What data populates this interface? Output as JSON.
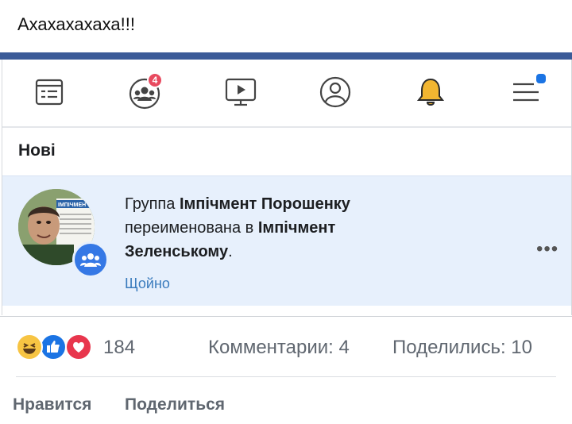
{
  "post": {
    "text": "Ахахахахаха!!!"
  },
  "screenshot": {
    "tabs": [
      {
        "icon": "feed-icon"
      },
      {
        "icon": "groups-icon",
        "badge": "4"
      },
      {
        "icon": "watch-icon"
      },
      {
        "icon": "profile-icon"
      },
      {
        "icon": "bell-icon"
      },
      {
        "icon": "menu-icon"
      }
    ],
    "section_title": "Нові",
    "notification": {
      "prefix": "Группа ",
      "old_name": "Імпічмент Порошенку",
      "middle": " переименована в ",
      "new_name": "Імпічмент Зеленському",
      "suffix": ".",
      "time": "Щойно",
      "more": "•••",
      "avatar_caption": "ІМПІЧМЕН"
    }
  },
  "footer": {
    "reactions": [
      "haha",
      "like",
      "love"
    ],
    "count": "184",
    "comments": "Комментарии: 4",
    "shares": "Поделились: 10",
    "like_label": "Нравится",
    "share_label": "Поделиться"
  },
  "colors": {
    "accent": "#3b5b98",
    "blue": "#1b74e4",
    "highlight": "#e7f0fc",
    "badge": "#e84a5f"
  }
}
